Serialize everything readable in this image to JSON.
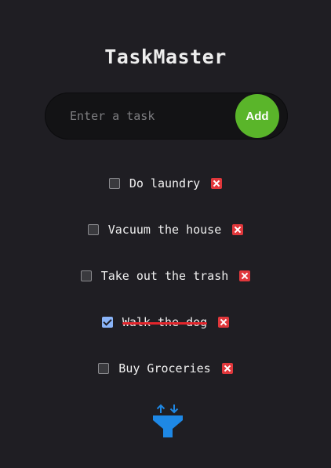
{
  "app": {
    "title": "TaskMaster"
  },
  "task_input": {
    "placeholder": "Enter a task",
    "value": ""
  },
  "add_button": {
    "label": "Add"
  },
  "tasks": [
    {
      "text": "Do laundry",
      "completed": false
    },
    {
      "text": "Vacuum the house",
      "completed": false
    },
    {
      "text": "Take out the trash",
      "completed": false
    },
    {
      "text": "Walk the dog",
      "completed": true
    },
    {
      "text": "Buy Groceries",
      "completed": false
    }
  ],
  "icons": {
    "delete": "close-icon",
    "sort_filter": "sort-filter-icon"
  },
  "colors": {
    "background": "#1f1e23",
    "add_button": "#5ab52a",
    "delete": "#e0373b",
    "checked": "#8ab4f8",
    "strikethrough": "#e3262c",
    "filter_icon": "#1e88e5"
  }
}
